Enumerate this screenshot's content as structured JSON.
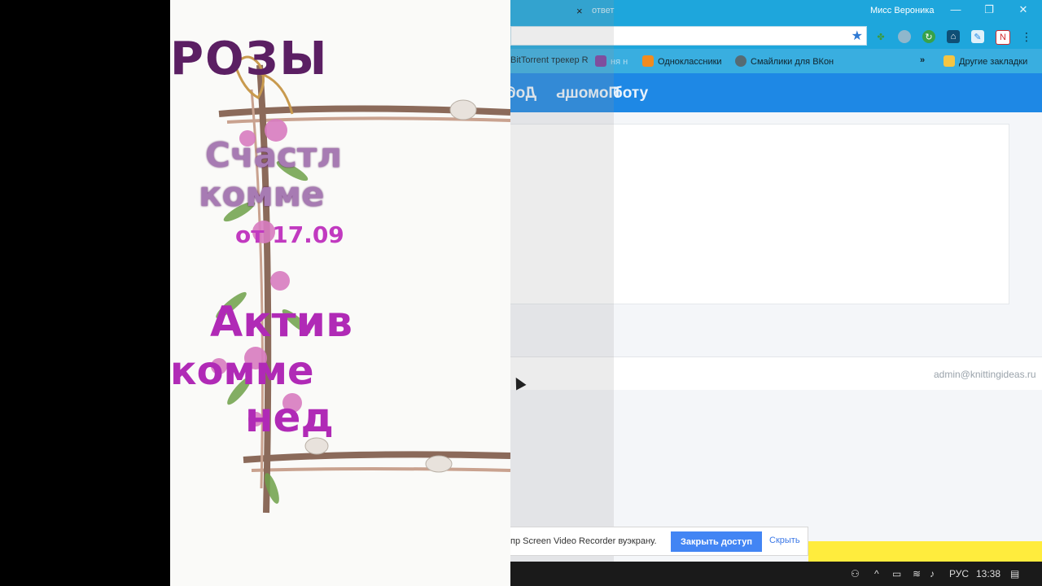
{
  "slide": {
    "title": "РОЗЫ",
    "lucky_line1": "Счастл",
    "lucky_line2": "комме",
    "date": "от 17.09",
    "active_line1": "Актив",
    "active_line2": "комме",
    "active_line3": "нед"
  },
  "browser": {
    "tab_close": "×",
    "tab_fragment": "ответ",
    "window_user": "Мисс Вероника",
    "controls": {
      "minimize": "—",
      "restore": "❐",
      "close": "✕"
    },
    "bookmarks": [
      {
        "label": "BitTorrent трекер R"
      },
      {
        "label": "ня н"
      },
      {
        "label": "Одноклассники"
      },
      {
        "label": "Смайлики для ВКон"
      }
    ],
    "bookmarks_more": "»",
    "other_bookmarks": "Другие закладки",
    "nav_left": "Доб",
    "nav_help": "Помощь",
    "nav_right": "боту",
    "footer_email": "admin@knittingideas.ru"
  },
  "share_notice": {
    "text": "пр Screen Video Recorder вуэкрану.",
    "stop_button": "Закрыть доступ",
    "hide_link": "Скрыть"
  },
  "taskbar": {
    "language": "РУС",
    "time": "13:38"
  },
  "colors": {
    "title_bar": "#1ea6dc",
    "header": "#1e88e5",
    "button": "#4285f4",
    "notice_bar": "#ffec3d"
  }
}
